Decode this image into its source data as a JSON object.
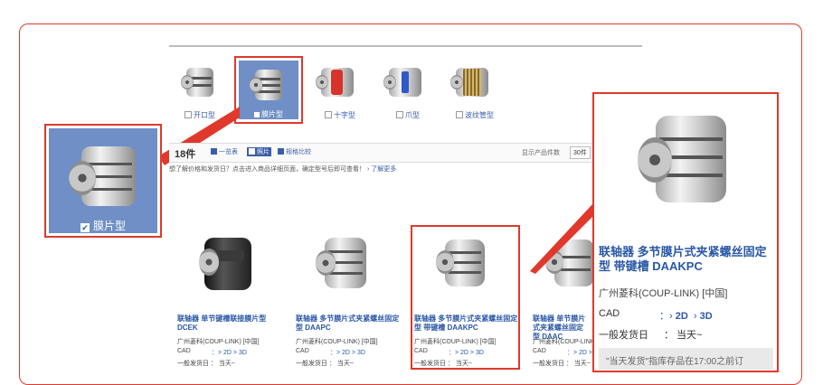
{
  "types": [
    {
      "label": "开口型",
      "checked": false
    },
    {
      "label": "膜片型",
      "checked": true
    },
    {
      "label": "十字型",
      "checked": false
    },
    {
      "label": "爪型",
      "checked": false
    },
    {
      "label": "波纹管型",
      "checked": false
    }
  ],
  "zoom": {
    "label": "膜片型"
  },
  "toolbar": {
    "count": "18件",
    "view_list": "一览表",
    "view_photo": "照片",
    "view_compare": "规格比较",
    "per_page_label": "显示产品件数",
    "per_page_value": "30件"
  },
  "hint": {
    "text": "想了解价格和发货日？点击进入商品详细页面，确定型号后即可查看！",
    "more": "了解更多"
  },
  "products": [
    {
      "title": "联轴器 单节键槽联接膜片型 DCEK",
      "vendor": "广州菱科(COUP-LINK) [中国]",
      "cad_label": "CAD",
      "cad_links": "：> 2D  > 3D",
      "ship": "一般发货日 ： 当天~"
    },
    {
      "title": "联轴器 多节膜片式夹紧螺丝固定型 DAAPC",
      "vendor": "广州菱科(COUP-LINK) [中国]",
      "cad_label": "CAD",
      "cad_links": "：> 2D  > 3D",
      "ship": "一般发货日 ： 当天~"
    },
    {
      "title": "联轴器 多节膜片式夹紧螺丝固定型 带键槽 DAAKPC",
      "vendor": "广州菱科(COUP-LINK) [中国]",
      "cad_label": "CAD",
      "cad_links": "：> 2D  > 3D",
      "ship": "一般发货日 ： 当天~"
    },
    {
      "title": "联轴器 单节膜片式夹紧螺丝固定型 DAAC",
      "vendor": "广州菱科(COUP-LINK) [中国]",
      "cad_label": "CAD",
      "cad_links": "：> 2D  > 3D",
      "ship": "一般发货日 ： 当天~"
    }
  ],
  "detail": {
    "title": "联轴器 多节膜片式夹紧螺丝固定型 带键槽 DAAKPC",
    "vendor": "广州菱科(COUP-LINK) [中国]",
    "cad_label": "CAD",
    "cad_2d": "2D",
    "cad_3d": "3D",
    "ship_label": "一般发货日",
    "ship_value": "：  当天~",
    "notice": "\"当天发货\"指库存品在17:00之前订"
  },
  "colors": {
    "accent": "#e0392c",
    "link": "#2a57a6",
    "selected_bg": "#6f8fc6"
  }
}
